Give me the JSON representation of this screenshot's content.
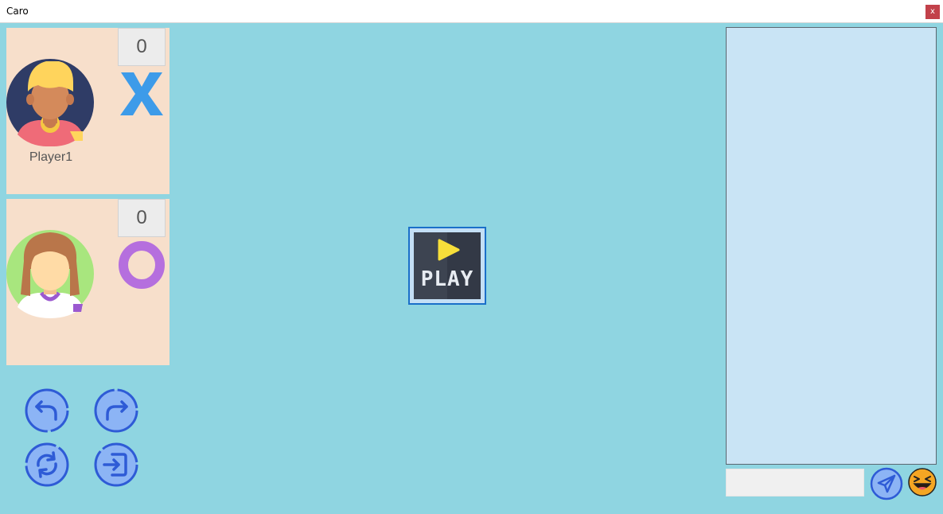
{
  "window": {
    "title": "Caro",
    "close_label": "x"
  },
  "players": [
    {
      "name": "Player1",
      "score": "0",
      "mark": "X",
      "mark_color": "#3d9be9"
    },
    {
      "name": "",
      "score": "0",
      "mark": "O",
      "mark_color": "#b56fde"
    }
  ],
  "controls": [
    {
      "name": "undo-icon"
    },
    {
      "name": "redo-icon"
    },
    {
      "name": "refresh-icon"
    },
    {
      "name": "exit-icon"
    }
  ],
  "play_button": {
    "label": "PLAY",
    "icon": "play-icon"
  },
  "chat": {
    "input_value": "",
    "send_icon": "send-icon",
    "emoji_icon": "laughing-emoji-icon"
  },
  "colors": {
    "background": "#8fd5e1",
    "panel": "#f7dfcb",
    "chat_bg": "#c9e4f5",
    "button_blue": "#2e5bd6"
  }
}
